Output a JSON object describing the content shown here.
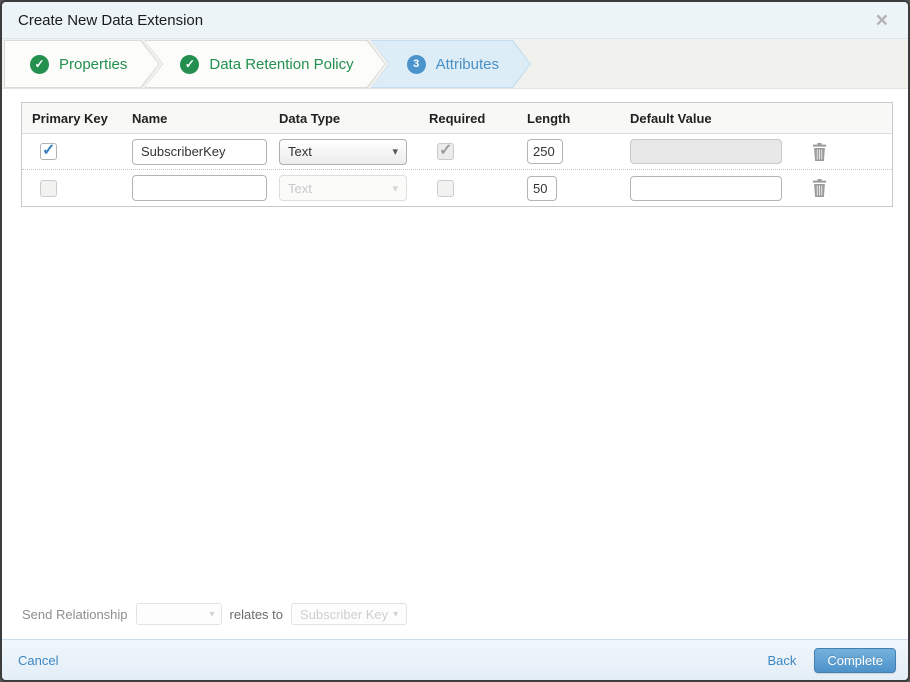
{
  "dialog": {
    "title": "Create New Data Extension"
  },
  "icons": {
    "close": "×",
    "check": "✓",
    "dropdown_arrow": "▾"
  },
  "steps": [
    {
      "label": "Properties",
      "status": "complete"
    },
    {
      "label": "Data Retention Policy",
      "status": "complete"
    },
    {
      "label": "Attributes",
      "status": "current",
      "number": "3"
    }
  ],
  "attributes_table": {
    "headers": {
      "primary_key": "Primary Key",
      "name": "Name",
      "data_type": "Data Type",
      "required": "Required",
      "length": "Length",
      "default_value": "Default Value"
    },
    "rows": [
      {
        "primary_key_checked": true,
        "name": "SubscriberKey",
        "data_type": "Text",
        "data_type_disabled": false,
        "required_checked": true,
        "required_disabled": true,
        "length": "250",
        "default_value": "",
        "default_value_disabled": true
      },
      {
        "primary_key_checked": false,
        "name": "",
        "data_type": "Text",
        "data_type_disabled": true,
        "required_checked": false,
        "required_disabled": false,
        "length": "50",
        "default_value": "",
        "default_value_disabled": false
      }
    ]
  },
  "send_relationship": {
    "label": "Send Relationship",
    "selected": "",
    "relates_to": "relates to",
    "target": "Subscriber Key"
  },
  "footer": {
    "cancel": "Cancel",
    "back": "Back",
    "complete": "Complete"
  },
  "colors": {
    "accent_green": "#23904f",
    "accent_blue": "#4a93cb",
    "step_active_bg": "#dcedf8",
    "titlebar_bg": "#edf4f8",
    "footer_bg": "#e9f2f9",
    "complete_button": "#5598cd"
  }
}
